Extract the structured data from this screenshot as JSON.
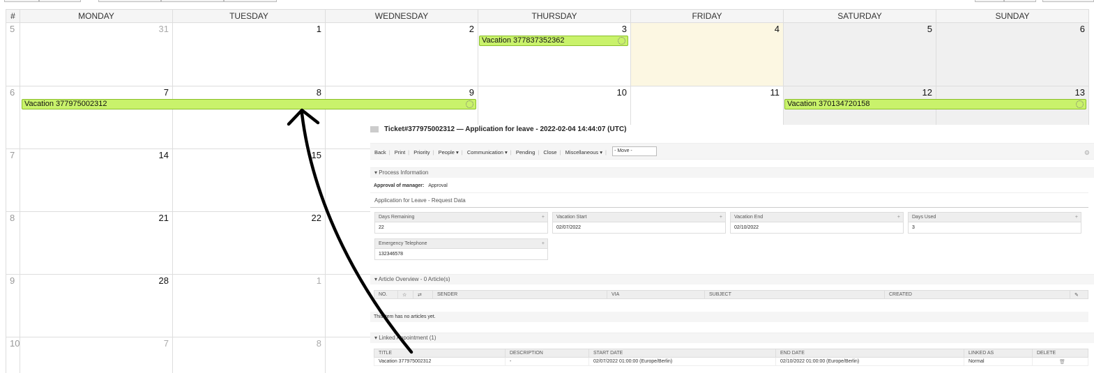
{
  "calendar": {
    "week_col_label": "#",
    "days": [
      "MONDAY",
      "TUESDAY",
      "WEDNESDAY",
      "THURSDAY",
      "FRIDAY",
      "SATURDAY",
      "SUNDAY"
    ],
    "weeks": [
      {
        "week": "5",
        "dates": [
          "31",
          "1",
          "2",
          "3",
          "4",
          "5",
          "6"
        ]
      },
      {
        "week": "6",
        "dates": [
          "7",
          "8",
          "9",
          "10",
          "11",
          "12",
          "13"
        ]
      },
      {
        "week": "7",
        "dates": [
          "14",
          "15",
          "",
          "",
          "",
          "",
          ""
        ]
      },
      {
        "week": "8",
        "dates": [
          "21",
          "22",
          "",
          "",
          "",
          "",
          ""
        ]
      },
      {
        "week": "9",
        "dates": [
          "28",
          "1",
          "",
          "",
          "",
          "",
          ""
        ]
      },
      {
        "week": "10",
        "dates": [
          "7",
          "8",
          "",
          "",
          "",
          "",
          ""
        ]
      }
    ],
    "events": {
      "e1": "Vacation 377837352362",
      "e2": "Vacation 377975002312",
      "e3": "Vacation 370134720158"
    }
  },
  "ticket": {
    "title": "Ticket#377975002312 — Application for leave - 2022-02-04 14:44:07 (UTC)",
    "toolbar": {
      "back": "Back",
      "print": "Print",
      "priority": "Priority",
      "people": "People ▾",
      "communication": "Communication ▾",
      "pending": "Pending",
      "close": "Close",
      "misc": "Miscellaneous ▾",
      "move": "- Move -"
    },
    "process": {
      "header": "▾ Process Information",
      "approval_label": "Approval of manager:",
      "approval_value": "Approval",
      "request_title": "Application for Leave - Request Data"
    },
    "fields": {
      "days_remaining": {
        "label": "Days Remaining",
        "value": "22"
      },
      "vacation_start": {
        "label": "Vacation Start",
        "value": "02/07/2022"
      },
      "vacation_end": {
        "label": "Vacation End",
        "value": "02/10/2022"
      },
      "days_used": {
        "label": "Days Used",
        "value": "3"
      },
      "emergency": {
        "label": "Emergency Telephone",
        "value": "132346578"
      }
    },
    "articles": {
      "header": "▾ Article Overview - 0 Article(s)",
      "cols": [
        "NO.",
        "☆",
        "⇄",
        "SENDER",
        "VIA",
        "SUBJECT",
        "CREATED",
        "✎"
      ],
      "empty_msg": "This item has no articles yet."
    },
    "linked": {
      "header": "▾ Linked Appointment (1)",
      "cols": [
        "TITLE",
        "DESCRIPTION",
        "START DATE",
        "END DATE",
        "LINKED AS",
        "DELETE"
      ],
      "row": {
        "title": "Vacation 377975002312",
        "description": "-",
        "start": "02/07/2022 01:00:00 (Europe/Berlin)",
        "end": "02/10/2022 01:00:00 (Europe/Berlin)",
        "linked_as": "Normal",
        "delete": "🗑"
      }
    }
  },
  "colors": {
    "event": "#c9f26b",
    "today": "#fcf7e2",
    "weekend": "#f0f0f0",
    "link": "#e8812b"
  }
}
